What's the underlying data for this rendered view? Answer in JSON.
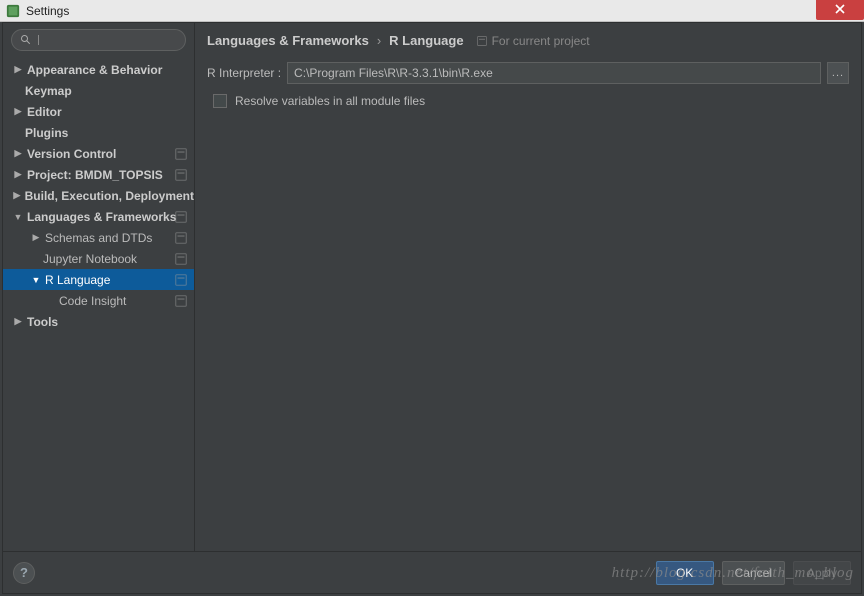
{
  "window": {
    "title": "Settings"
  },
  "search": {
    "placeholder": ""
  },
  "sidebar": {
    "items": [
      {
        "label": "Appearance & Behavior",
        "arrow": "right",
        "bold": true,
        "lvl": 0
      },
      {
        "label": "Keymap",
        "arrow": "none",
        "bold": true,
        "lvl": 0
      },
      {
        "label": "Editor",
        "arrow": "right",
        "bold": true,
        "lvl": 0
      },
      {
        "label": "Plugins",
        "arrow": "none",
        "bold": true,
        "lvl": 0
      },
      {
        "label": "Version Control",
        "arrow": "right",
        "bold": true,
        "proj": true,
        "lvl": 0
      },
      {
        "label": "Project: BMDM_TOPSIS",
        "arrow": "right",
        "bold": true,
        "proj": true,
        "lvl": 0
      },
      {
        "label": "Build, Execution, Deployment",
        "arrow": "right",
        "bold": true,
        "lvl": 0
      },
      {
        "label": "Languages & Frameworks",
        "arrow": "down",
        "bold": true,
        "proj": true,
        "lvl": 0
      },
      {
        "label": "Schemas and DTDs",
        "arrow": "right",
        "proj": true,
        "lvl": 1
      },
      {
        "label": "Jupyter Notebook",
        "arrow": "none",
        "proj": true,
        "lvl": 1
      },
      {
        "label": "R Language",
        "arrow": "down",
        "proj": true,
        "selected": true,
        "lvl": 1
      },
      {
        "label": "Code Insight",
        "arrow": "none",
        "proj": true,
        "lvl": 2
      },
      {
        "label": "Tools",
        "arrow": "right",
        "bold": true,
        "lvl": 0
      }
    ]
  },
  "breadcrumb": {
    "a": "Languages & Frameworks",
    "b": "R Language",
    "note": "For current project"
  },
  "form": {
    "interpreter_label": "R Interpreter :",
    "interpreter_path": "C:\\Program Files\\R\\R-3.3.1\\bin\\R.exe",
    "browse": "...",
    "resolve_label": "Resolve variables in all module files"
  },
  "buttons": {
    "ok": "OK",
    "cancel": "Cancel",
    "apply": "Apply",
    "help": "?"
  },
  "watermark": "http://blog.csdn.net/faith_mo_blog"
}
